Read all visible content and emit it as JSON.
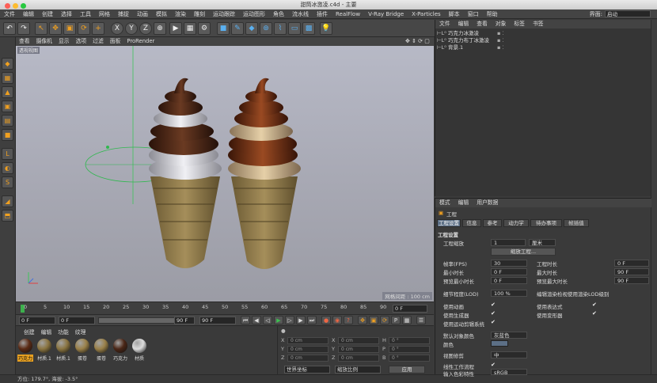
{
  "window": {
    "title": "甜筒冰激凌.c4d - 主要"
  },
  "menubar": {
    "items": [
      "文件",
      "编辑",
      "创建",
      "选择",
      "工具",
      "网格",
      "捕捉",
      "动画",
      "模拟",
      "渲染",
      "雕刻",
      "运动跟踪",
      "运动图形",
      "角色",
      "流水线",
      "插件",
      "RealFlow",
      "V-Ray Bridge",
      "X-Particles",
      "脚本",
      "窗口",
      "帮助"
    ],
    "layout_label": "界面:",
    "layout_value": "启动"
  },
  "toolbar": {
    "icons": [
      "undo-icon",
      "redo-icon",
      "select-arrow-icon",
      "move-icon",
      "scale-icon",
      "rotate-icon",
      "add-icon",
      "axis-x-icon",
      "axis-y-icon",
      "axis-z-icon",
      "world-coords-icon",
      "render-view-icon",
      "render-picture-icon",
      "render-settings-icon",
      "cube-icon",
      "pen-icon",
      "subdivision-icon",
      "cloner-icon",
      "deformer-icon",
      "floor-icon",
      "camera-icon",
      "light-icon"
    ],
    "labels": [
      "X",
      "Y",
      "Z"
    ]
  },
  "viewport": {
    "menu": [
      "查看",
      "摄像机",
      "显示",
      "选项",
      "过滤",
      "面板",
      "ProRender"
    ],
    "label": "透视视图",
    "grid_info": "网格间距 : 100 cm"
  },
  "timeline": {
    "ticks": [
      "0",
      "5",
      "10",
      "15",
      "20",
      "25",
      "30",
      "35",
      "40",
      "45",
      "50",
      "55",
      "60",
      "65",
      "70",
      "75",
      "80",
      "85",
      "90"
    ],
    "end_label": "0 F"
  },
  "transport": {
    "start_field": "0 F",
    "current_field": "0 F",
    "end_field": "90 F",
    "end_field2": "90 F"
  },
  "materials": {
    "menu": [
      "创建",
      "编辑",
      "功能",
      "纹理"
    ],
    "items": [
      {
        "label": "巧克力",
        "color": "#5a2a14"
      },
      {
        "label": "材质.1",
        "color": "#8a7440"
      },
      {
        "label": "材质.1",
        "color": "#8a7440"
      },
      {
        "label": "蛋卷",
        "color": "#9a8048"
      },
      {
        "label": "蛋卷",
        "color": "#9a8048"
      },
      {
        "label": "巧克力",
        "color": "#4a2616"
      },
      {
        "label": "材质",
        "color": "#dcdcdc"
      }
    ]
  },
  "coordinates": {
    "header": "●",
    "rows": [
      {
        "a": "X",
        "av": "0 cm",
        "b": "X",
        "bv": "0 cm",
        "c": "H",
        "cv": "0 °"
      },
      {
        "a": "Y",
        "av": "0 cm",
        "b": "Y",
        "bv": "0 cm",
        "c": "P",
        "cv": "0 °"
      },
      {
        "a": "Z",
        "av": "0 cm",
        "b": "Z",
        "bv": "0 cm",
        "c": "B",
        "cv": "0 °"
      }
    ],
    "world": "世界坐标",
    "scale": "缩放比例",
    "apply": "应用"
  },
  "status": {
    "text": "方位: 179.7°, 海拔: -3.5°"
  },
  "objects": {
    "menu": [
      "文件",
      "编辑",
      "查看",
      "对象",
      "标签",
      "书签"
    ],
    "rows": [
      "巧克力冰激凌",
      "巧克力布丁冰激凌",
      "背景.1"
    ]
  },
  "attributes": {
    "menu": [
      "模式",
      "编辑",
      "用户数据"
    ],
    "section_icon": "工程",
    "tabs": [
      "工程设置",
      "信息",
      "参考",
      "动力学",
      "待办事项",
      "帧插值"
    ],
    "section_title": "工程设置",
    "fields": {
      "scale_label": "工程缩放",
      "scale_value": "1",
      "scale_unit": "厘米",
      "scale_button": "缩放工程...",
      "fps_label": "帧率(FPS)",
      "fps_value": "30",
      "project_time_label": "工程时长",
      "project_time_value": "0 F",
      "min_time_label": "最小时长",
      "min_time_value": "0 F",
      "max_time_label": "最大时长",
      "max_time_value": "90 F",
      "preview_min_label": "预览最小时长",
      "preview_min_value": "0 F",
      "preview_max_label": "预览最大时长",
      "preview_max_value": "90 F",
      "lod_label": "细节程度(LOD)",
      "lod_value": "100 %",
      "lod_render_label": "编辑渲染检视使用渲染LOD级别",
      "use_anim": "使用动画",
      "use_expr": "使用表达式",
      "use_gen": "使用生成器",
      "use_deform": "使用变形器",
      "use_motion": "使用运动剪辑系统",
      "default_color_label": "默认对象颜色",
      "default_color_value": "灰蓝色",
      "color_label": "颜色",
      "view_clip_label": "视图修剪",
      "view_clip_value": "中",
      "linear_label": "线性工作流程",
      "input_color_label": "输入色彩特性",
      "input_color_value": "sRGB"
    }
  }
}
